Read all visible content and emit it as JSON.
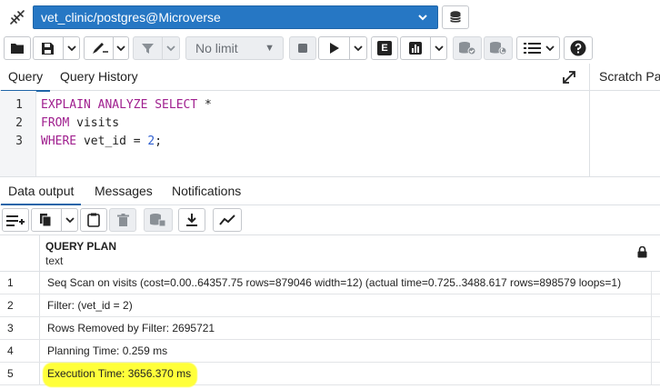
{
  "connection": {
    "label": "vet_clinic/postgres@Microverse",
    "accent": "#2677c4"
  },
  "toolbar": {
    "limit_label": "No limit",
    "explain_label": "E"
  },
  "query_tabs": [
    {
      "label": "Query"
    },
    {
      "label": "Query History"
    }
  ],
  "scratch_pad": {
    "label": "Scratch Pad"
  },
  "editor": {
    "line_numbers": [
      "1",
      "2",
      "3"
    ],
    "lines": [
      {
        "kw": "EXPLAIN ANALYZE SELECT",
        "rest": " *"
      },
      {
        "kw": "FROM",
        "rest": " visits"
      },
      {
        "kw": "WHERE",
        "rest": " vet_id = ",
        "num": "2",
        "tail": ";"
      }
    ]
  },
  "output_tabs": [
    {
      "label": "Data output"
    },
    {
      "label": "Messages"
    },
    {
      "label": "Notifications"
    }
  ],
  "grid": {
    "column": {
      "name": "QUERY PLAN",
      "type": "text"
    },
    "rows": [
      {
        "n": "1",
        "value": "Seq Scan on visits (cost=0.00..64357.75 rows=879046 width=12) (actual time=0.725..3488.617 rows=898579 loops=1)"
      },
      {
        "n": "2",
        "value": "Filter: (vet_id = 2)"
      },
      {
        "n": "3",
        "value": "Rows Removed by Filter: 2695721"
      },
      {
        "n": "4",
        "value": "Planning Time: 0.259 ms"
      },
      {
        "n": "5",
        "value": "Execution Time: 3656.370 ms"
      }
    ],
    "highlight_color": "#ffff3a"
  }
}
